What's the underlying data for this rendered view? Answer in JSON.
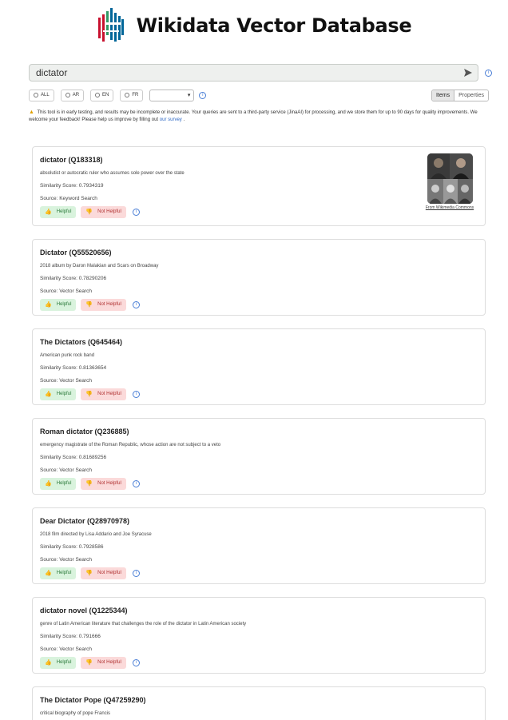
{
  "app": {
    "title": "Wikidata Vector Database"
  },
  "search": {
    "value": "dictator",
    "send_icon": "send-arrow-icon"
  },
  "filters": {
    "languages": [
      "ALL",
      "AR",
      "EN",
      "FR"
    ],
    "select_value": "",
    "mode_tabs": [
      "Items",
      "Properties"
    ],
    "active_tab": "Items"
  },
  "notice": {
    "text": "This tool is in early testing, and results may be incomplete or inaccurate. Your queries are sent to a third-party service (JinaAI) for processing, and we store them for up to 90 days for quality improvements. We welcome your feedback! Please help us improve by filling out",
    "link": "our survey",
    "end": "."
  },
  "labels": {
    "helpful": "Helpful",
    "not_helpful": "Not Helpful",
    "thumb_caption": "From Wikimedia Commons"
  },
  "results": [
    {
      "title": "dictator (Q183318)",
      "description": "absolutist or autocratic ruler who assumes sole power over the state",
      "score": "Similarity Score: 0.7934319",
      "source": "Source: Keyword Search"
    },
    {
      "title": "Dictator (Q55520656)",
      "description": "2018 album by Daron Malakian and Scars on Broadway",
      "score": "Similarity Score: 0.78290206",
      "source": "Source: Vector Search"
    },
    {
      "title": "The Dictators (Q645464)",
      "description": "American punk rock band",
      "score": "Similarity Score: 0.81363654",
      "source": "Source: Vector Search"
    },
    {
      "title": "Roman dictator (Q236885)",
      "description": "emergency magistrate of the Roman Republic, whose action are not subject to a veto",
      "score": "Similarity Score: 0.81689256",
      "source": "Source: Vector Search"
    },
    {
      "title": "Dear Dictator (Q28970978)",
      "description": "2018 film directed by Lisa Addario and Joe Syracuse",
      "score": "Similarity Score: 0.7928586",
      "source": "Source: Vector Search"
    },
    {
      "title": "dictator novel (Q1225344)",
      "description": "genre of Latin American literature that challenges the role of the dictator in Latin American society",
      "score": "Similarity Score: 0.791666",
      "source": "Source: Vector Search"
    },
    {
      "title": "The Dictator Pope (Q47259290)",
      "description": "critical biography of pope Francis"
    }
  ]
}
